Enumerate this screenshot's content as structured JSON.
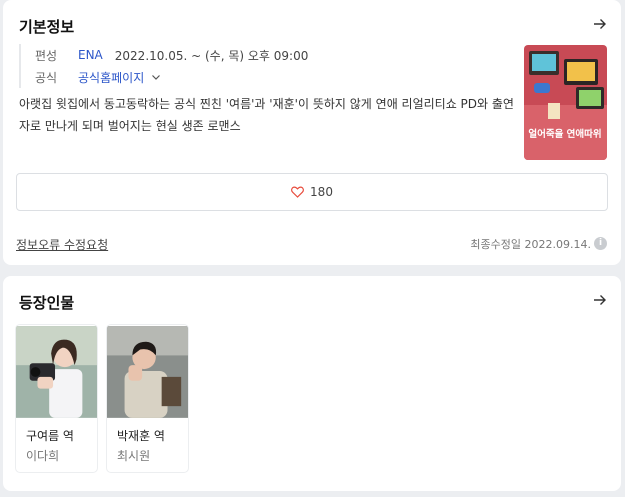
{
  "info": {
    "title": "기본정보",
    "broadcast_label": "편성",
    "channel": "ENA",
    "schedule": "2022.10.05. ~  (수, 목) 오후 09:00",
    "official_label": "공식",
    "homepage": "공식홈페이지",
    "synopsis": "아랫집 윗집에서 동고동락하는 공식 찐친 '여름'과 '재훈'이 뜻하지 않게 연애 리얼리티쇼 PD와 출연자로 만나게 되며 벌어지는 현실 생존 로맨스",
    "poster_title": "얼어죽을 연애따위",
    "likes": "180",
    "report": "정보오류 수정요청",
    "updated": "최종수정일 2022.09.14.",
    "info_icon": "i"
  },
  "cast": {
    "title": "등장인물",
    "members": [
      {
        "role": "구여름 역",
        "name": "이다희"
      },
      {
        "role": "박재훈 역",
        "name": "최시원"
      }
    ]
  },
  "colors": {
    "accent_blue": "#2c56c9",
    "heart_red": "#e84c3d",
    "background": "#eceef1"
  },
  "icons": [
    "arrow-right-icon",
    "chevron-down-icon",
    "heart-icon",
    "info-icon"
  ]
}
